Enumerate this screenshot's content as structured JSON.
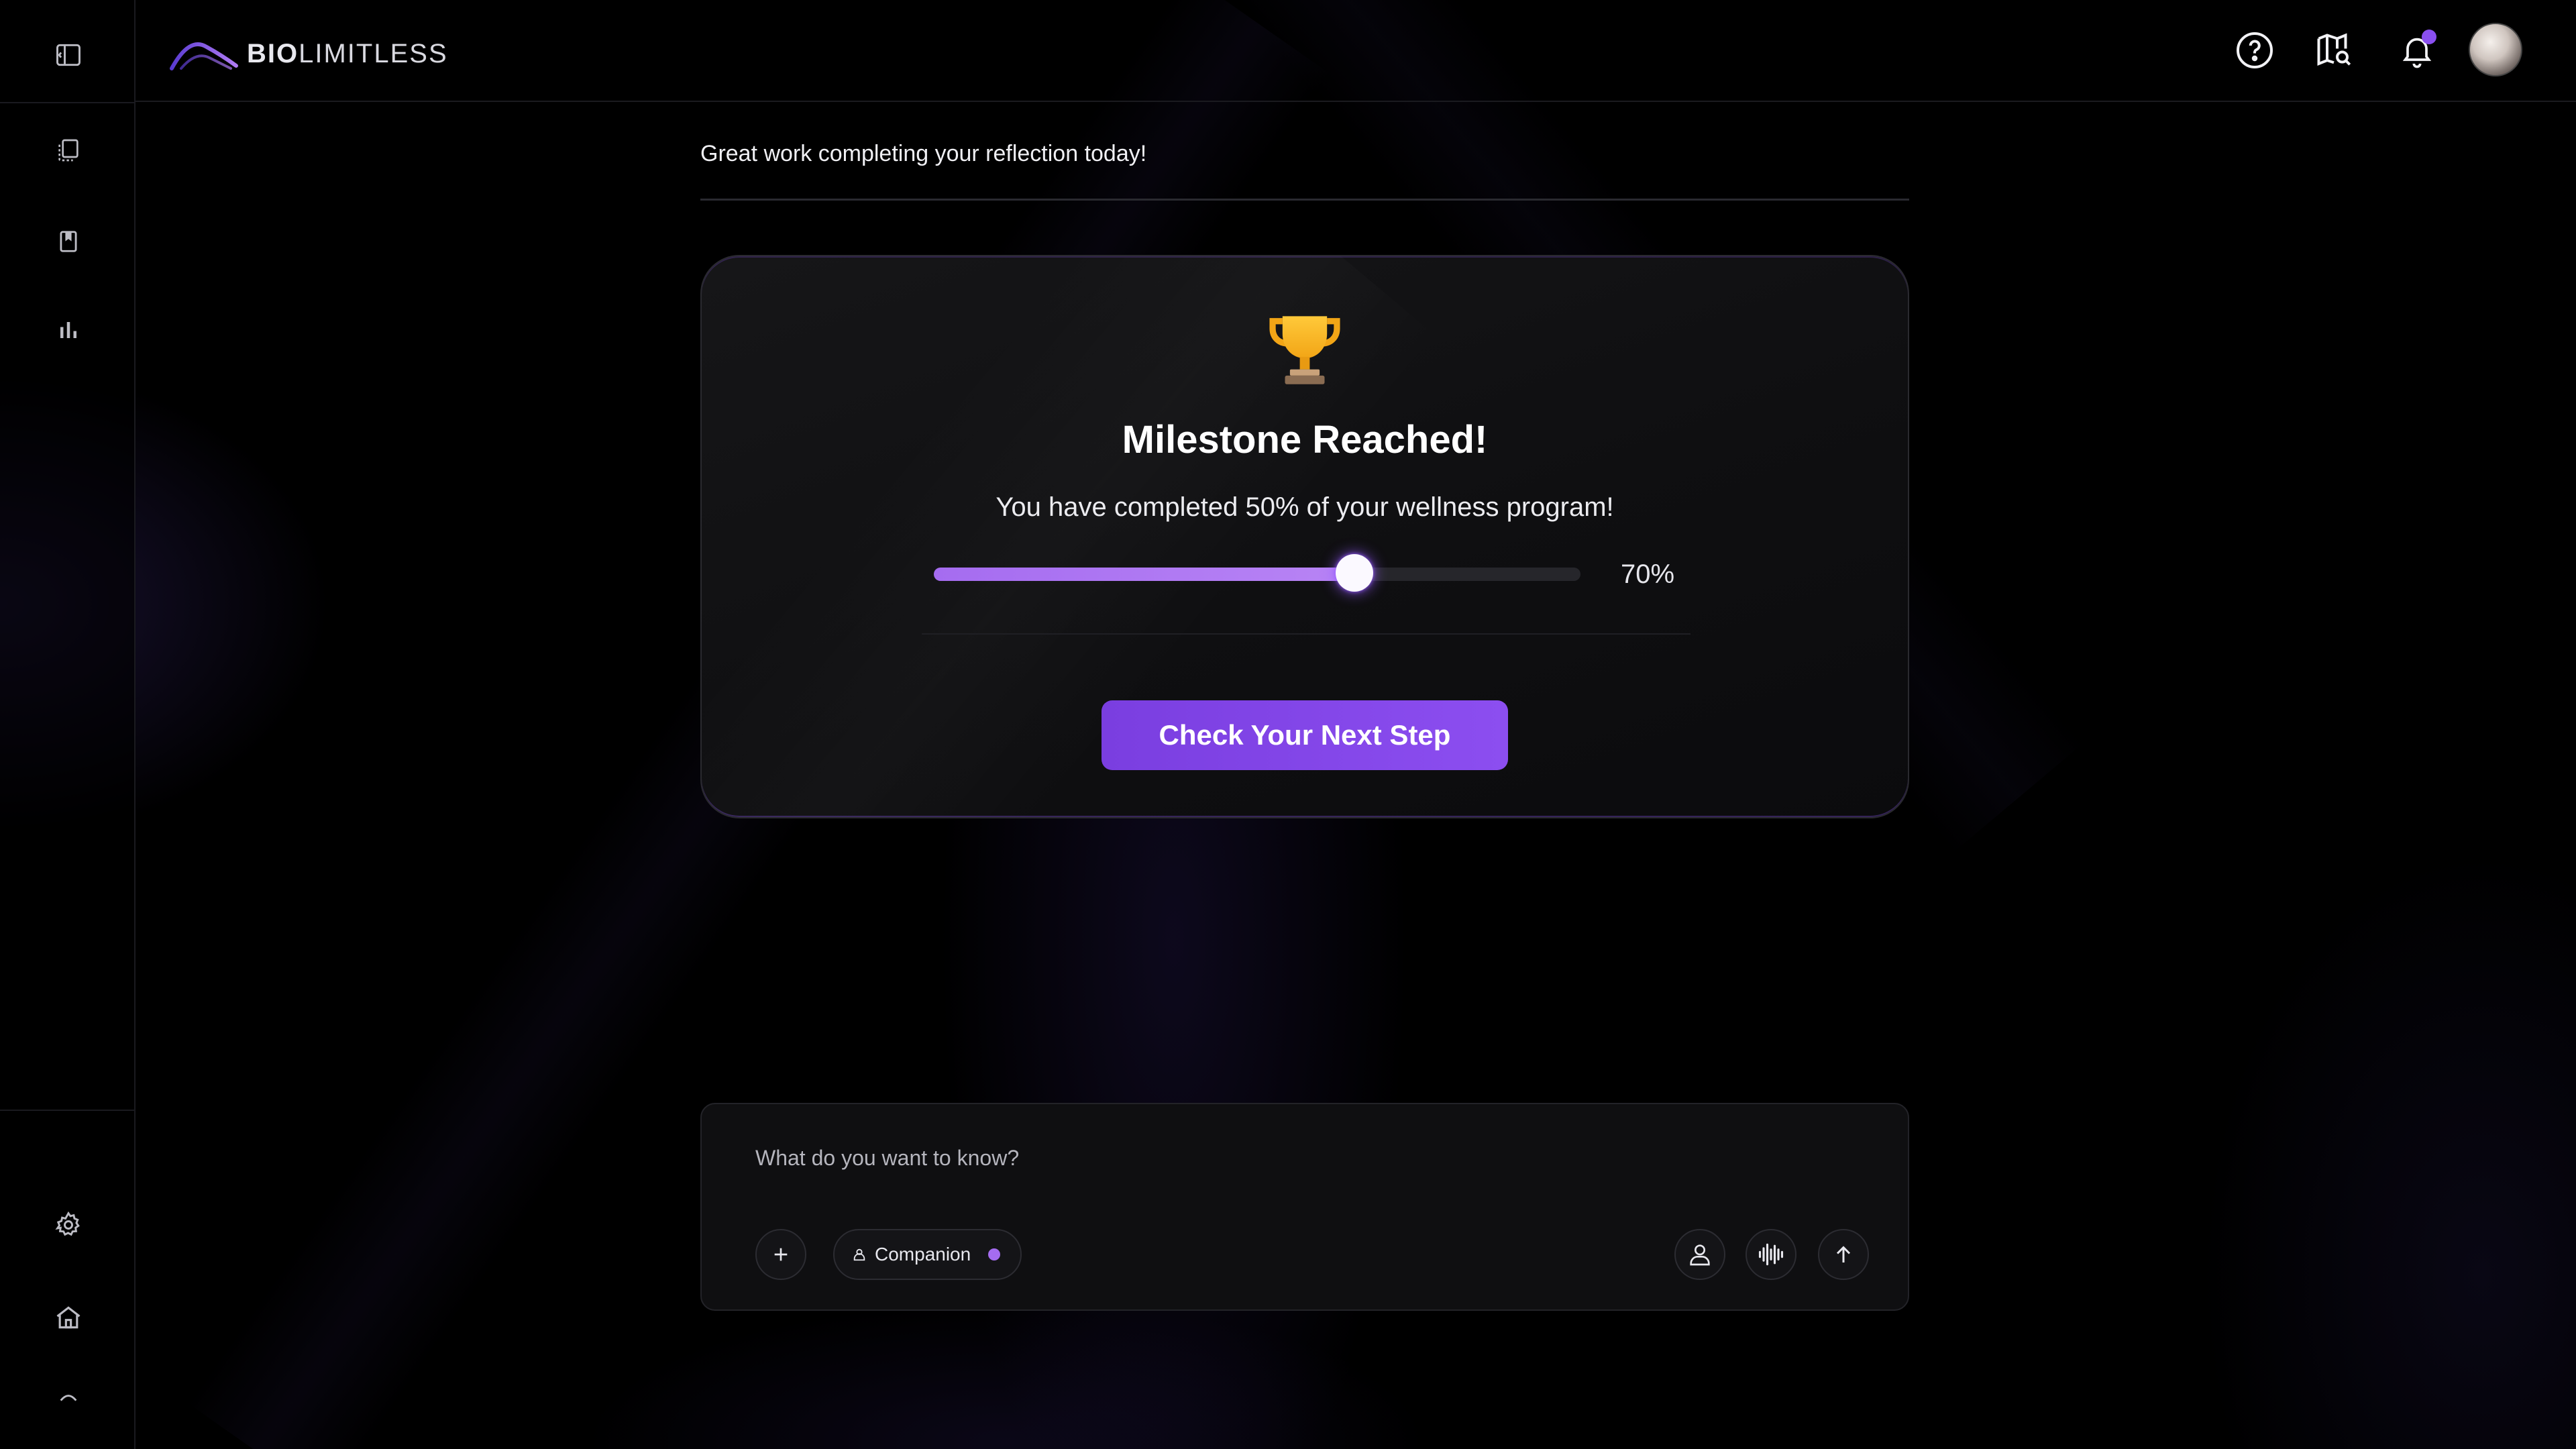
{
  "app": {
    "brand_bold": "BIO",
    "brand_light": "LIMITLESS"
  },
  "sidebar": {
    "top_items": [
      {
        "icon": "sidebar-toggle-icon"
      },
      {
        "icon": "pages-icon"
      },
      {
        "icon": "bookmark-icon"
      },
      {
        "icon": "bar-chart-icon"
      }
    ],
    "bottom_items": [
      {
        "icon": "gear-icon"
      },
      {
        "icon": "home-icon"
      },
      {
        "icon": "chevron-up-icon"
      }
    ]
  },
  "header": {
    "icons": [
      "help-icon",
      "map-search-icon",
      "bell-icon"
    ],
    "has_notification": true
  },
  "main": {
    "welcome_text": "Great work completing your reflection today!",
    "card": {
      "icon": "trophy-icon",
      "title": "Milestone Reached!",
      "subtitle": "You have completed 50% of your wellness program!",
      "slider_value_percent": 65,
      "slider_label": "70%",
      "cta_label": "Check Your Next Step"
    }
  },
  "chat": {
    "placeholder": "What do you want to know?",
    "mode_label": "Companion",
    "mode_dot_color": "#a56cf0"
  },
  "colors": {
    "accent": "#8c4ef0",
    "background": "#000000"
  }
}
